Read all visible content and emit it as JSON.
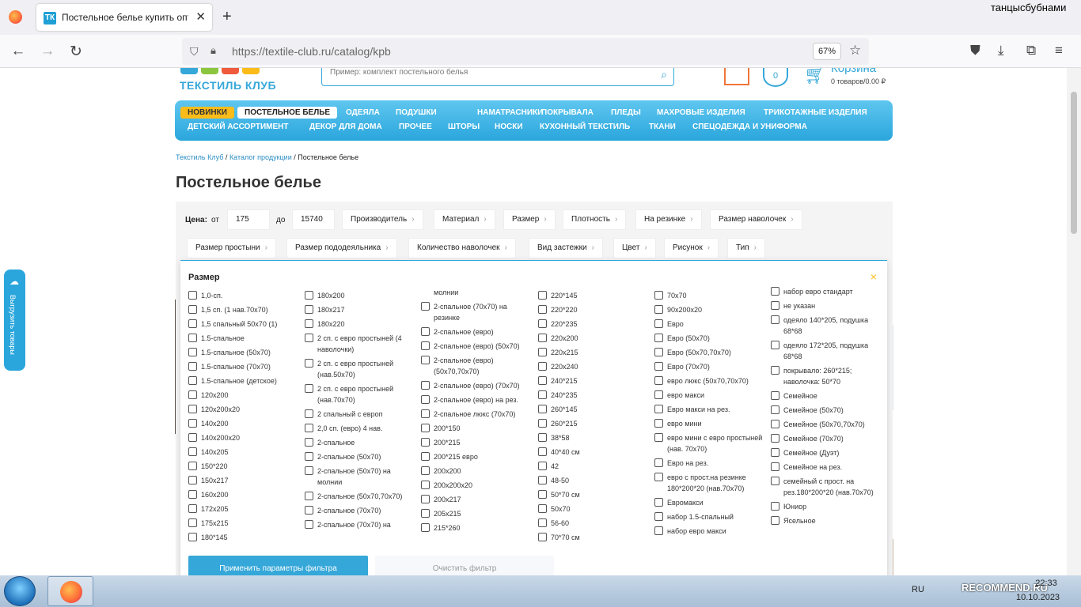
{
  "browser": {
    "tab_title": "Постельное белье купить опт",
    "tab_favicon": "ТК",
    "url_host": "https://textile-club.ru",
    "url_path": "/catalog/kpb",
    "zoom": "67%",
    "user_label": "танцысбубнами"
  },
  "header": {
    "logo_text": "ТЕКСТИЛЬ КЛУБ",
    "search_placeholder": "Пример: комплект постельного белья",
    "wishlist_count": "0",
    "cart_title": "Корзина",
    "cart_summary": "0 товаров/0.00 ₽"
  },
  "menu": {
    "row1": [
      "НОВИНКИ",
      "ПОСТЕЛЬНОЕ БЕЛЬЕ",
      "ОДЕЯЛА",
      "ПОДУШКИ",
      "НАМАТРАСНИКИ",
      "ПОКРЫВАЛА",
      "ПЛЕДЫ",
      "МАХРОВЫЕ ИЗДЕЛИЯ",
      "ТРИКОТАЖНЫЕ ИЗДЕЛИЯ"
    ],
    "row2": [
      "ДЕТСКИЙ АССОРТИМЕНТ",
      "ДЕКОР ДЛЯ ДОМА",
      "ПРОЧЕЕ",
      "ШТОРЫ",
      "НОСКИ",
      "КУХОННЫЙ ТЕКСТИЛЬ",
      "ТКАНИ",
      "СПЕЦОДЕЖДА И УНИФОРМА"
    ]
  },
  "breadcrumbs": {
    "home": "Текстиль Клуб",
    "catalog": "Каталог продукции",
    "current": "Постельное белье",
    "sep": "/"
  },
  "page_title": "Постельное белье",
  "filters": {
    "price_label": "Цена:",
    "from_label": "от",
    "from_value": "175",
    "to_label": "до",
    "to_value": "15740",
    "row1": [
      "Производитель",
      "Материал",
      "Размер",
      "Плотность",
      "На резинке",
      "Размер наволочек"
    ],
    "row2": [
      "Размер простыни",
      "Размер пододеяльника",
      "Количество наволочек",
      "Вид застежки",
      "Цвет",
      "Рисунок",
      "Тип"
    ]
  },
  "size_popup": {
    "title": "Размер",
    "close": "×",
    "columns": [
      [
        "1,0-сп.",
        "1,5 сп. (1 нав.70х70)",
        "1,5 спальный 50х70 (1)",
        "1.5-спальное",
        "1.5-спальное (50х70)",
        "1.5-спальное (70х70)",
        "1.5-спальное (детское)",
        "120x200",
        "120x200x20",
        "140x200",
        "140x200x20",
        "140x205",
        "150*220",
        "150x217",
        "160x200",
        "172x205",
        "175x215",
        "180*145"
      ],
      [
        "180x200",
        "180x217",
        "180x220",
        "2 сп. с евро простыней (4 наволочки)",
        "2 сп. с евро простыней (нав.50х70)",
        "2 сп. с евро простыней (нав.70х70)",
        "2 спальный с европ",
        "2,0 сп. (евро) 4 нав.",
        "2-спальное",
        "2-спальное (50x70)",
        "2-спальное (50х70) на молнии",
        "2-спальное (50х70,70х70)",
        "2-спальное (70х70)",
        "2-спальное (70х70) на"
      ],
      [
        "молнии",
        "2-спальное (70х70) на резинке",
        "2-спальное (евро)",
        "2-спальное (евро) (50х70)",
        "2-спальное (евро) (50х70,70х70)",
        "2-спальное (евро) (70х70)",
        "2-спальное (евро) на рез.",
        "2-спальное люкс (70х70)",
        "200*150",
        "200*215",
        "200*215 евро",
        "200x200",
        "200x200x20",
        "200x217",
        "205x215",
        "215*260"
      ],
      [
        "220*145",
        "220*220",
        "220*235",
        "220x200",
        "220x215",
        "220x240",
        "240*215",
        "240*235",
        "260*145",
        "260*215",
        "38*58",
        "40*40 см",
        "42",
        "48-50",
        "50*70 см",
        "50x70",
        "56-60",
        "70*70 см"
      ],
      [
        "70x70",
        "90x200x20",
        "Евро",
        "Евро (50х70)",
        "Евро (50х70,70х70)",
        "Евро (70х70)",
        "евро люкс (50х70,70х70)",
        "евро макси",
        "Евро макси на рез.",
        "евро мини",
        "евро мини с евро простыней (нав. 70х70)",
        "Евро на рез.",
        "евро с прост.на резинке 180*200*20 (нав.70х70)",
        "Евромакси",
        "набор 1.5-спальный",
        "набор евро макси"
      ],
      [
        "набор евро стандарт",
        "не указан",
        "одеяло 140*205, подушка 68*68",
        "одеяло 172*205, подушка 68*68",
        "покрывало: 260*215; наволочка: 50*70",
        "Семейное",
        "Семейное (50х70)",
        "Семейное (50х70,70х70)",
        "Семейное (70х70)",
        "Семейное (Дуэт)",
        "Семейное на рез.",
        "семейный с прост. на рез.180*200*20 (нав.70х70)",
        "Юниор",
        "Ясельное"
      ]
    ],
    "apply_label": "Применить параметры фильтра",
    "clear_label": "Очистить фильтр"
  },
  "side_tab_label": "Выгрузить товары",
  "taskbar": {
    "lang": "RU",
    "time": "22:33",
    "date": "10.10.2023",
    "watermark": "RECOMMEND.RU"
  },
  "colors": {
    "accent": "#35a7d8",
    "new_badge": "#fbbc1a",
    "gift": "#f07638"
  }
}
